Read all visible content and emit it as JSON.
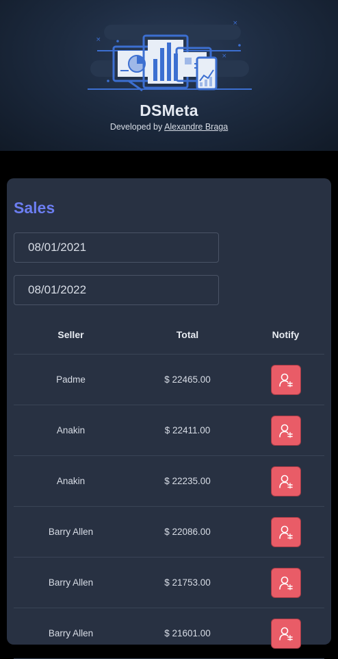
{
  "header": {
    "title": "DSMeta",
    "developed_by": "Developed by",
    "author": "Alexandre Braga",
    "logo_icon": "dashboard-illustration-icon"
  },
  "sales": {
    "title": "Sales",
    "date_min": "08/01/2021",
    "date_max": "08/01/2022",
    "columns": {
      "seller": "Seller",
      "total": "Total",
      "notify": "Notify"
    },
    "notify_icon": "user-notify-icon",
    "rows": [
      {
        "seller": "Padme",
        "total": "$ 22465.00"
      },
      {
        "seller": "Anakin",
        "total": "$ 22411.00"
      },
      {
        "seller": "Anakin",
        "total": "$ 22235.00"
      },
      {
        "seller": "Barry Allen",
        "total": "$ 22086.00"
      },
      {
        "seller": "Barry Allen",
        "total": "$ 21753.00"
      },
      {
        "seller": "Barry Allen",
        "total": "$ 21601.00"
      }
    ]
  },
  "colors": {
    "accent": "#6c7ef2",
    "card": "#283142",
    "button": "#e95c67",
    "background": "#000000"
  }
}
